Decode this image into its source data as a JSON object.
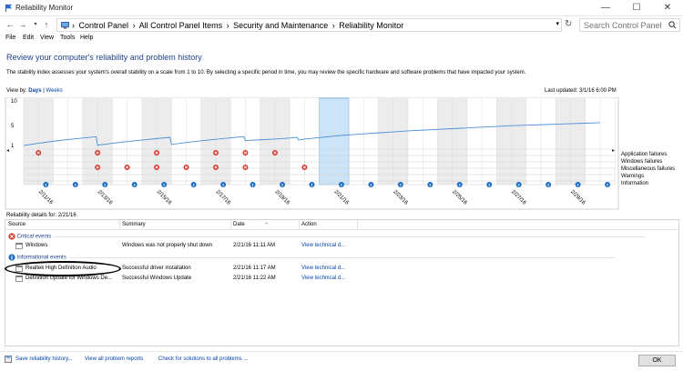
{
  "window": {
    "title": "Reliability Monitor"
  },
  "address": {
    "crumbs": [
      "Control Panel",
      "All Control Panel Items",
      "Security and Maintenance",
      "Reliability Monitor"
    ],
    "search_placeholder": "Search Control Panel"
  },
  "menu": [
    "File",
    "Edit",
    "View",
    "Tools",
    "Help"
  ],
  "heading": "Review your computer's reliability and problem history",
  "description": "The stability index assesses your system's overall stability on a scale from 1 to 10. By selecting a specific period in time, you may review the specific hardware and software problems that have impacted your system.",
  "view_by": {
    "label": "View by:",
    "days": "Days",
    "sep": "|",
    "weeks": "Weeks"
  },
  "last_updated": "Last updated: 3/1/16 6:00 PM",
  "chart_data": {
    "type": "line",
    "y_ticks": [
      "10",
      "5",
      "1"
    ],
    "ylim": [
      1,
      10
    ],
    "dates": [
      "2/11/16",
      "2/13/16",
      "2/15/16",
      "2/17/16",
      "2/19/16",
      "2/21/16",
      "2/23/16",
      "2/25/16",
      "2/27/16",
      "2/29/16"
    ],
    "selected_date": "2/21/16",
    "row_labels": [
      "Application failures",
      "Windows failures",
      "Miscellaneous failures",
      "Warnings",
      "Information"
    ],
    "stability_index": [
      [
        0,
        1.0
      ],
      [
        1,
        1.45
      ],
      [
        2,
        1.85
      ],
      [
        3,
        2.2
      ],
      [
        4,
        2.5
      ],
      [
        4.9,
        2.78
      ],
      [
        5,
        1.05
      ],
      [
        6,
        1.45
      ],
      [
        7,
        1.8
      ],
      [
        8,
        2.1
      ],
      [
        9,
        2.4
      ],
      [
        9.9,
        2.65
      ],
      [
        10,
        1.2
      ],
      [
        11,
        1.6
      ],
      [
        12,
        1.95
      ],
      [
        13,
        2.25
      ],
      [
        14,
        2.55
      ],
      [
        14.9,
        2.8
      ],
      [
        15,
        2.0
      ],
      [
        16,
        2.15
      ],
      [
        17,
        2.3
      ],
      [
        18,
        2.5
      ],
      [
        18.5,
        2.65
      ],
      [
        18.6,
        2.1
      ],
      [
        19,
        2.3
      ],
      [
        20,
        2.6
      ],
      [
        21,
        2.9
      ],
      [
        22,
        3.15
      ],
      [
        23,
        3.35
      ],
      [
        24,
        3.55
      ],
      [
        25,
        3.75
      ],
      [
        26,
        3.95
      ],
      [
        27,
        4.1
      ],
      [
        28,
        4.25
      ],
      [
        29,
        4.4
      ],
      [
        30,
        4.55
      ],
      [
        31,
        4.7
      ],
      [
        32,
        4.85
      ],
      [
        33,
        5.0
      ],
      [
        34,
        5.1
      ],
      [
        35,
        5.2
      ],
      [
        36,
        5.3
      ],
      [
        37,
        5.4
      ],
      [
        38,
        5.5
      ],
      [
        39,
        5.6
      ]
    ],
    "critical_app": [
      1,
      3,
      5,
      7,
      8,
      9
    ],
    "critical_misc": [
      3,
      4,
      5,
      6,
      7,
      8,
      10
    ],
    "info": [
      0,
      1,
      2,
      3,
      4,
      5,
      6,
      7,
      8,
      9,
      10,
      11,
      12,
      13,
      14,
      15,
      16,
      17,
      18,
      19
    ]
  },
  "details": {
    "label": "Reliability details for: 2/21/16",
    "columns": [
      "Source",
      "Summary",
      "Date",
      "Action"
    ],
    "critical_group": "Critical events",
    "info_group": "Informational events",
    "critical_rows": [
      {
        "source": "Windows",
        "summary": "Windows was not properly shut down",
        "date": "2/21/16 11:11 AM",
        "action": "View  technical d..."
      }
    ],
    "info_rows": [
      {
        "source": "Realtek High Definition Audio",
        "summary": "Successful driver installation",
        "date": "2/21/16 11:17 AM",
        "action": "View  technical d..."
      },
      {
        "source": "Definition Update for Windows De...",
        "summary": "Successful Windows Update",
        "date": "2/21/16 11:22 AM",
        "action": "View  technical d..."
      }
    ]
  },
  "footer": {
    "save": "Save reliability history...",
    "view_all": "View all problem reports",
    "check": "Check for solutions to all problems ...",
    "ok": "OK"
  }
}
